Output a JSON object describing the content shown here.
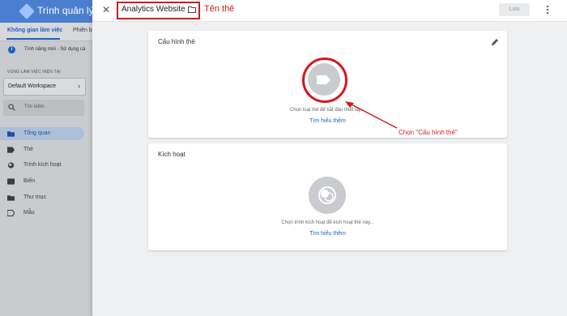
{
  "app": {
    "title": "Trình quản lý thẻ",
    "tabs": [
      "Không gian làm việc",
      "Phiên b"
    ],
    "notice": "Tính năng mới - Sử dụng cá"
  },
  "sidebar": {
    "section_label": "VÙNG LÀM VIỆC HIỆN TẠI",
    "workspace": "Default Workspace",
    "search_placeholder": "Tìm kiếm",
    "items": [
      {
        "label": "Tổng quan",
        "icon": "folder-icon",
        "active": true
      },
      {
        "label": "Thẻ",
        "icon": "tag-icon",
        "active": false
      },
      {
        "label": "Trình kích hoạt",
        "icon": "trigger-icon",
        "active": false
      },
      {
        "label": "Biến",
        "icon": "variable-icon",
        "active": false
      },
      {
        "label": "Thư mục",
        "icon": "folder-icon",
        "active": false
      },
      {
        "label": "Mẫu",
        "icon": "template-icon",
        "active": false
      }
    ]
  },
  "panel": {
    "tag_name": "Analytics Website",
    "save_label": "Lưu",
    "card_config": {
      "title": "Cấu hình thẻ",
      "hint": "Chọn loại thẻ để bắt đầu thiết lập...",
      "link": "Tìm hiểu thêm"
    },
    "card_trigger": {
      "title": "Kích hoạt",
      "hint": "Chọn trình kích hoạt để kích hoạt thẻ này...",
      "link": "Tìm hiểu thêm"
    }
  },
  "annotations": {
    "name_label": "Tên thẻ",
    "choose_label": "Chọn \"Cấu hình thẻ\"",
    "color": "#d21a1a"
  },
  "colors": {
    "accent": "#1f5fbf",
    "link": "#1a66cc"
  }
}
